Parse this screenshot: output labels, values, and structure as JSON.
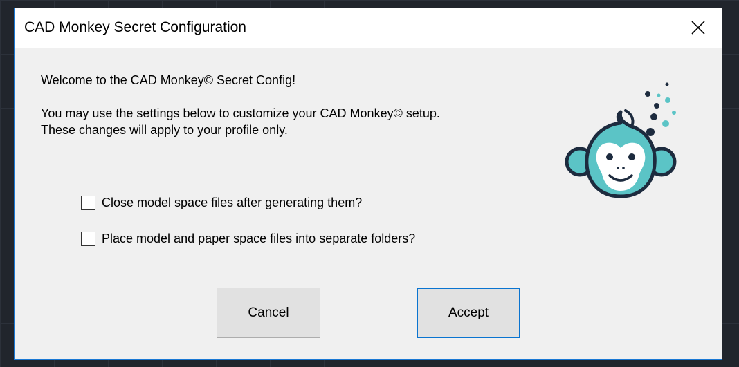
{
  "window": {
    "title": "CAD Monkey Secret Configuration",
    "close_icon": "close-icon"
  },
  "content": {
    "welcome": "Welcome to the CAD Monkey© Secret Config!",
    "description_line1": "You may use the settings below to customize your CAD Monkey© setup.",
    "description_line2": "These changes will apply to your profile only."
  },
  "options": [
    {
      "label": "Close model space files after generating them?",
      "checked": false
    },
    {
      "label": "Place model and paper space files into separate folders?",
      "checked": false
    }
  ],
  "buttons": {
    "cancel_label": "Cancel",
    "accept_label": "Accept"
  },
  "colors": {
    "accent": "#0a74d0",
    "mascot_teal": "#5bc4c6",
    "mascot_dark": "#1d2b3e"
  },
  "icons": {
    "mascot": "monkey-logo"
  }
}
